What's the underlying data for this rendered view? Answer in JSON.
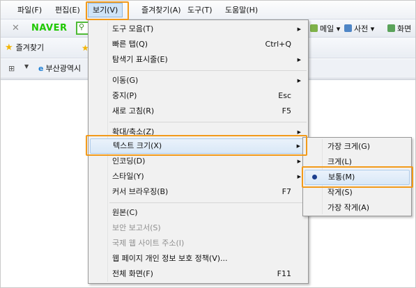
{
  "menubar": {
    "items": [
      "파일(F)",
      "편집(E)",
      "보기(V)",
      "즐겨찾기(A)",
      "도구(T)",
      "도움말(H)"
    ],
    "active_index": 2
  },
  "toolbar1": {
    "close_glyph": "✕",
    "brand": "NAVER",
    "search_glyph": "⚲",
    "mail_label": "메일",
    "dictionary_label": "사전",
    "screen_label": "화면"
  },
  "toolbar2": {
    "favorites_label": "즐겨찾기"
  },
  "tabrow": {
    "tab_title": "부산광역시"
  },
  "view_menu": {
    "items": [
      {
        "label": "도구 모음(T)",
        "shortcut": "",
        "submenu": true,
        "disabled": false
      },
      {
        "label": "빠른 탭(Q)",
        "shortcut": "Ctrl+Q",
        "submenu": false,
        "disabled": false
      },
      {
        "label": "탐색기 표시줄(E)",
        "shortcut": "",
        "submenu": true,
        "disabled": false
      },
      {
        "label": "이동(G)",
        "shortcut": "",
        "submenu": true,
        "disabled": false
      },
      {
        "label": "중지(P)",
        "shortcut": "Esc",
        "submenu": false,
        "disabled": false
      },
      {
        "label": "새로 고침(R)",
        "shortcut": "F5",
        "submenu": false,
        "disabled": false
      },
      {
        "label": "확대/축소(Z)",
        "shortcut": "",
        "submenu": true,
        "disabled": false
      },
      {
        "label": "텍스트 크기(X)",
        "shortcut": "",
        "submenu": true,
        "disabled": false,
        "highlighted": true
      },
      {
        "label": "인코딩(D)",
        "shortcut": "",
        "submenu": true,
        "disabled": false
      },
      {
        "label": "스타일(Y)",
        "shortcut": "",
        "submenu": true,
        "disabled": false
      },
      {
        "label": "커서 브라우징(B)",
        "shortcut": "F7",
        "submenu": false,
        "disabled": false
      },
      {
        "label": "원본(C)",
        "shortcut": "",
        "submenu": false,
        "disabled": false
      },
      {
        "label": "보안 보고서(S)",
        "shortcut": "",
        "submenu": false,
        "disabled": true
      },
      {
        "label": "국제 웹 사이트 주소(I)",
        "shortcut": "",
        "submenu": false,
        "disabled": true
      },
      {
        "label": "웹 페이지 개인 정보 보호 정책(V)...",
        "shortcut": "",
        "submenu": false,
        "disabled": false
      },
      {
        "label": "전체 화면(F)",
        "shortcut": "F11",
        "submenu": false,
        "disabled": false
      }
    ]
  },
  "text_size_menu": {
    "items": [
      {
        "label": "가장 크게(G)",
        "selected": false
      },
      {
        "label": "크게(L)",
        "selected": false
      },
      {
        "label": "보통(M)",
        "selected": true
      },
      {
        "label": "작게(S)",
        "selected": false
      },
      {
        "label": "가장 작게(A)",
        "selected": false
      }
    ]
  },
  "colors": {
    "highlight_outline": "#f29a1a",
    "naver_green": "#1ec800",
    "hover_fill": "#d9e8f7",
    "radio_bullet": "#1c3f8f"
  }
}
